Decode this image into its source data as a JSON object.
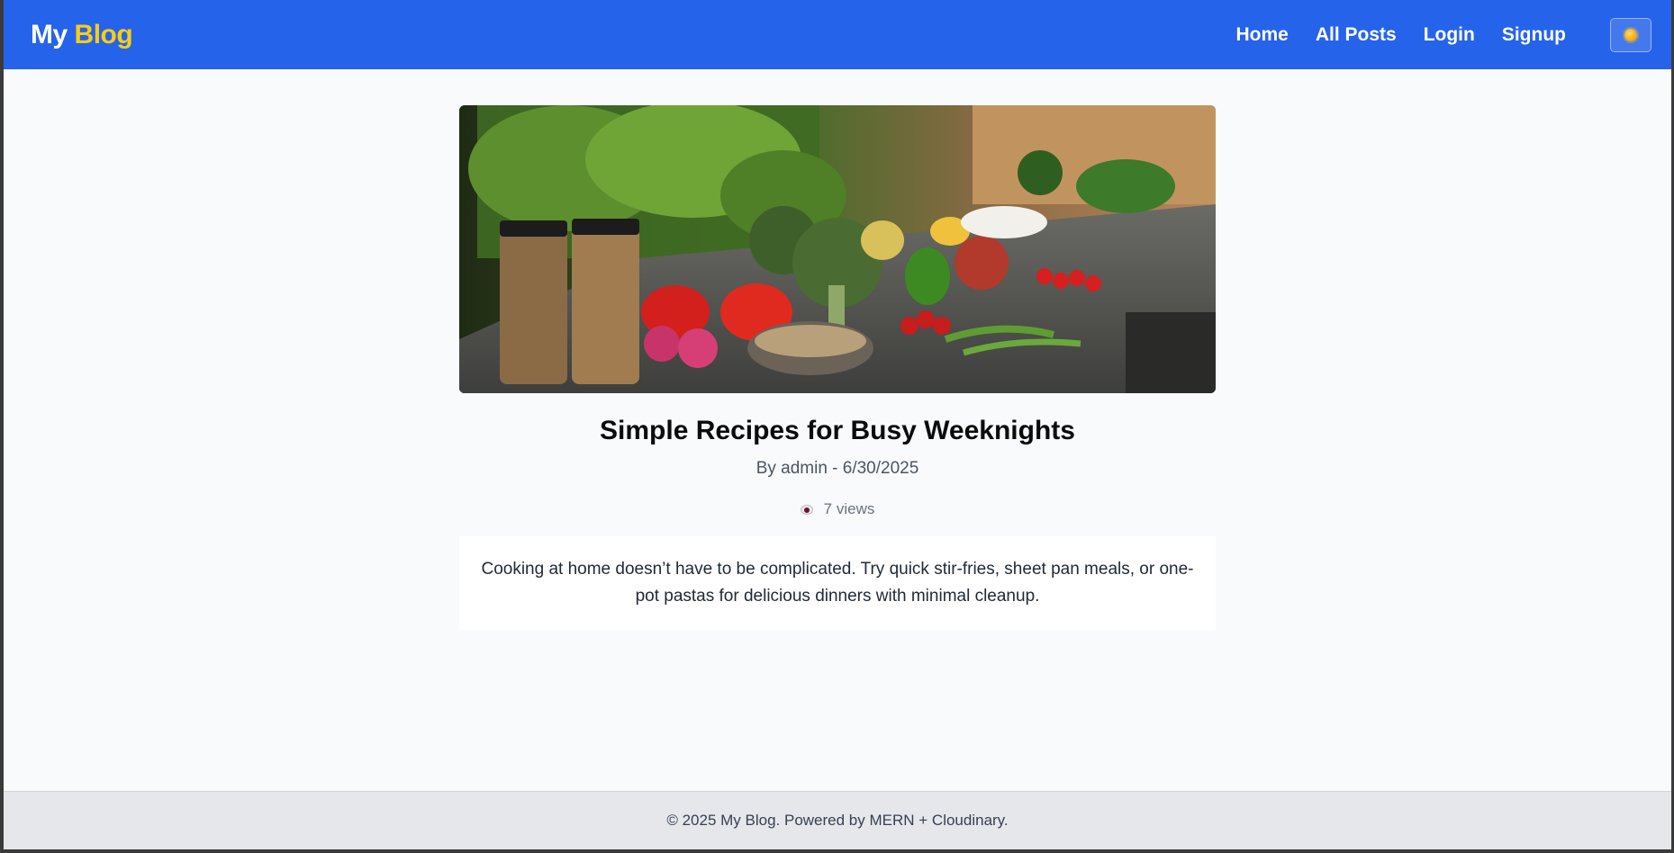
{
  "navbar": {
    "brand_primary": "My",
    "brand_accent": "Blog",
    "links": [
      {
        "label": "Home"
      },
      {
        "label": "All Posts"
      },
      {
        "label": "Login"
      },
      {
        "label": "Signup"
      }
    ],
    "theme_toggle_icon": "sun-icon"
  },
  "post": {
    "image_icon": "hero-image",
    "title": "Simple Recipes for Busy Weeknights",
    "meta": "By admin - 6/30/2025",
    "views_icon": "eye-icon",
    "views": "7 views",
    "content": "Cooking at home doesn’t have to be complicated. Try quick stir-fries, sheet pan meals, or one-pot pastas for delicious dinners with minimal cleanup."
  },
  "footer": {
    "text": "© 2025 My Blog. Powered by MERN + Cloudinary."
  },
  "colors": {
    "nav_background": "#2563eb",
    "brand_accent": "#facc15",
    "page_background": "#f8fafc",
    "footer_background": "#e5e7eb"
  }
}
